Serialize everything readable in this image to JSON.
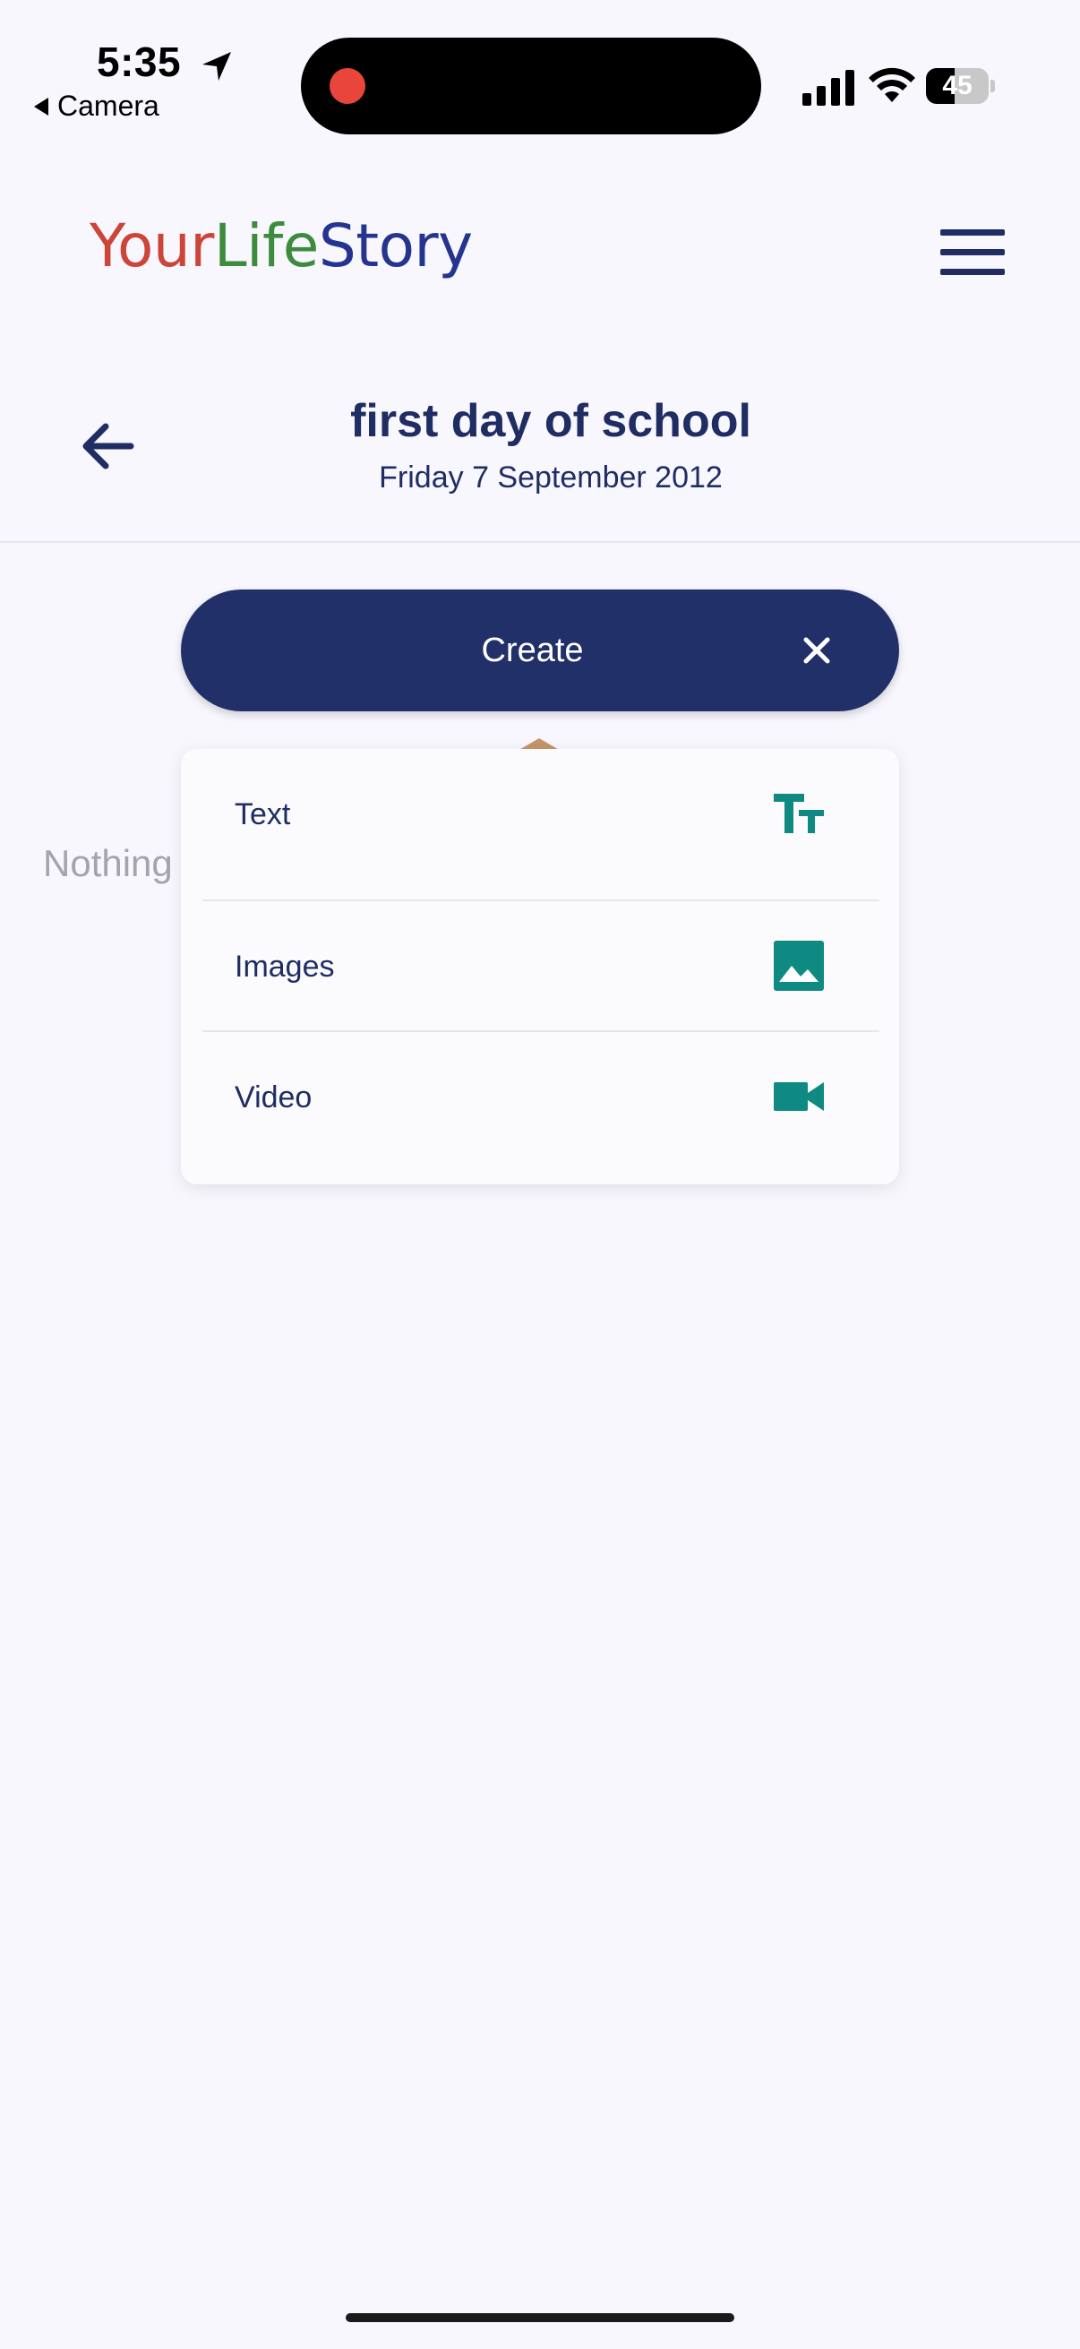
{
  "status_bar": {
    "time": "5:35",
    "back_label": "Camera",
    "battery_level": "45"
  },
  "app": {
    "logo": {
      "part1": "Your",
      "part2": "Life",
      "part3": "Story"
    },
    "colors": {
      "primary": "#22306a",
      "accent": "#0e8a82",
      "red": "#cc4538",
      "green": "#3d8b3d"
    }
  },
  "page": {
    "title": "first day of school",
    "date": "Friday 7 September 2012",
    "empty_text": "Nothing"
  },
  "create_button": {
    "label": "Create"
  },
  "create_menu": {
    "items": [
      {
        "label": "Text",
        "icon": "text-format-icon"
      },
      {
        "label": "Images",
        "icon": "image-icon"
      },
      {
        "label": "Video",
        "icon": "videocam-icon"
      }
    ]
  }
}
